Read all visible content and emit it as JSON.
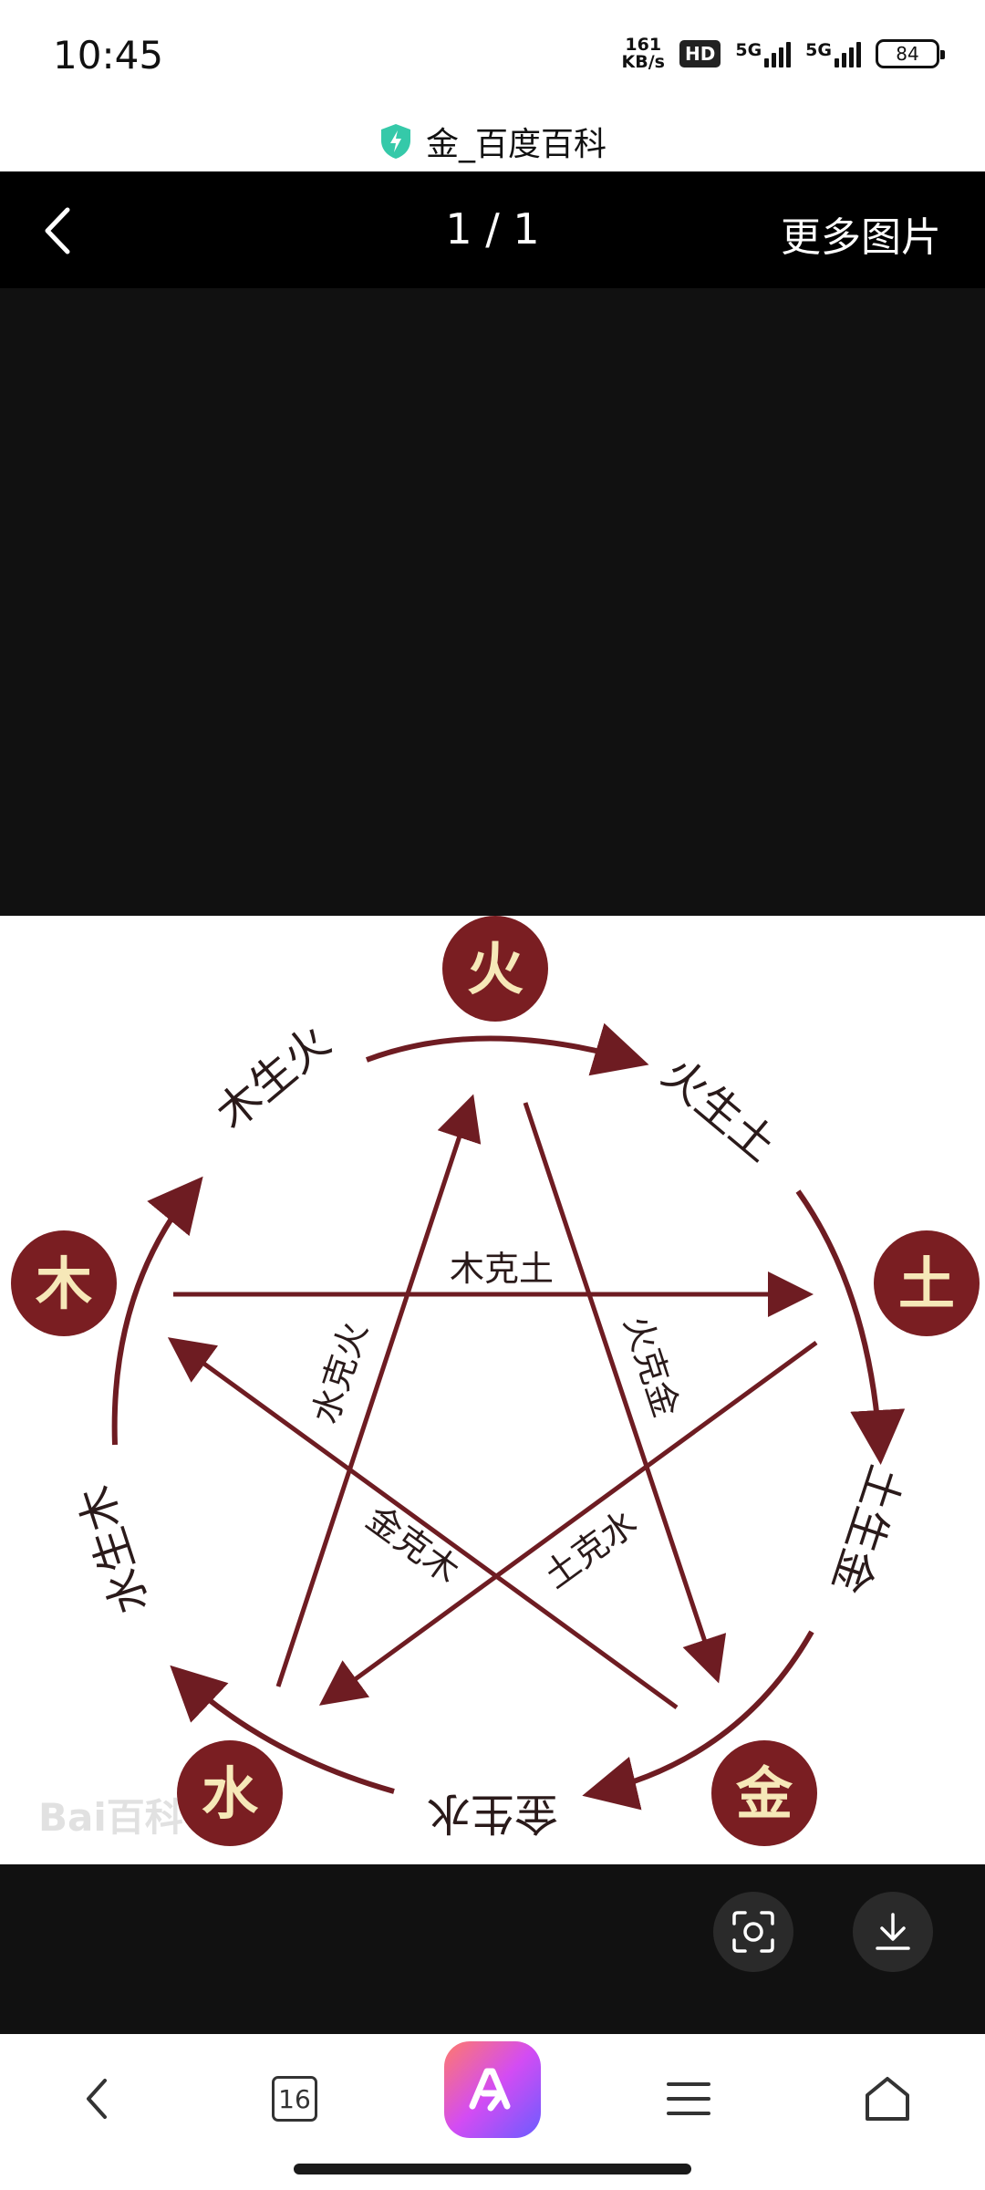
{
  "status": {
    "time": "10:45",
    "speed_value": "161",
    "speed_unit": "KB/s",
    "hd": "HD",
    "net1": "5G",
    "net2": "5G",
    "battery": "84"
  },
  "site": {
    "title": "金_百度百科"
  },
  "top_bar": {
    "counter": "1 / 1",
    "more_images": "更多图片"
  },
  "diagram": {
    "elements": {
      "fire": "火",
      "earth": "土",
      "metal": "金",
      "water": "水",
      "wood": "木"
    },
    "generating": {
      "wood_fire": "木生火",
      "fire_earth": "火生土",
      "earth_metal": "土生金",
      "metal_water": "金生水",
      "water_wood": "水生木"
    },
    "overcoming": {
      "wood_earth": "木克土",
      "fire_metal": "火克金",
      "earth_water": "土克水",
      "metal_wood": "金克木",
      "water_fire": "水克火"
    },
    "watermark": "Bai百科"
  },
  "colors": {
    "element_circle": "#7a1e22",
    "element_text": "#f6e8b8",
    "arrow": "#6e1c22"
  },
  "bottom_nav": {
    "tabs_count": "16"
  }
}
